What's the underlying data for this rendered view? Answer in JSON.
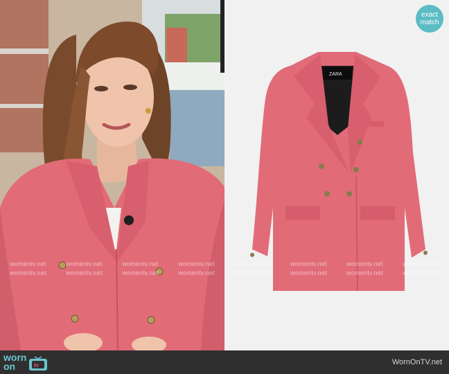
{
  "badge": {
    "line1": "exact",
    "line2": "match"
  },
  "watermark": {
    "text": "womentv.net"
  },
  "product": {
    "tag_brand": "ZARA"
  },
  "footer": {
    "logo_line1": "worn",
    "logo_line2": "on",
    "logo_tv": "tv",
    "site_name": "WornOnTV.net"
  },
  "colors": {
    "blazer": "#e26b78",
    "teal": "#5bbcc6",
    "pink_logo": "#e5508b"
  }
}
